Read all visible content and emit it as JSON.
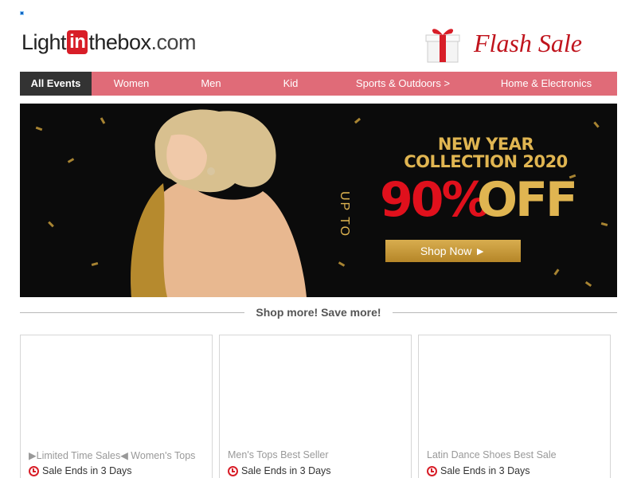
{
  "header": {
    "logo": {
      "part1": "Light",
      "part2": "in",
      "part3": "thebox",
      "part4": ".com"
    },
    "flash_sale": "Flash Sale"
  },
  "nav": {
    "items": [
      {
        "label": "All Events",
        "active": true
      },
      {
        "label": "Women"
      },
      {
        "label": "Men"
      },
      {
        "label": "Kid"
      },
      {
        "label": "Sports & Outdoors >"
      },
      {
        "label": "Home & Electronics"
      }
    ]
  },
  "banner": {
    "line1": "NEW YEAR",
    "line2": "COLLECTION 2020",
    "upto": "UP TO",
    "percent": "90%",
    "off": "OFF",
    "cta": "Shop Now ►"
  },
  "section": {
    "title": "Shop more! Save more!"
  },
  "cards": [
    {
      "title": "▶Limited Time Sales◀ Women's Tops",
      "ends": "Sale Ends in 3 Days"
    },
    {
      "title": "Men's Tops Best Seller",
      "ends": "Sale Ends in 3 Days"
    },
    {
      "title": "Latin Dance Shoes Best Sale",
      "ends": "Sale Ends in 3 Days"
    }
  ],
  "icons": {
    "gift": "gift-icon",
    "clock": "clock-icon"
  },
  "colors": {
    "nav": "#e06b78",
    "active_nav": "#333333",
    "brand_red": "#c0141d",
    "gold": "#e0b551"
  }
}
